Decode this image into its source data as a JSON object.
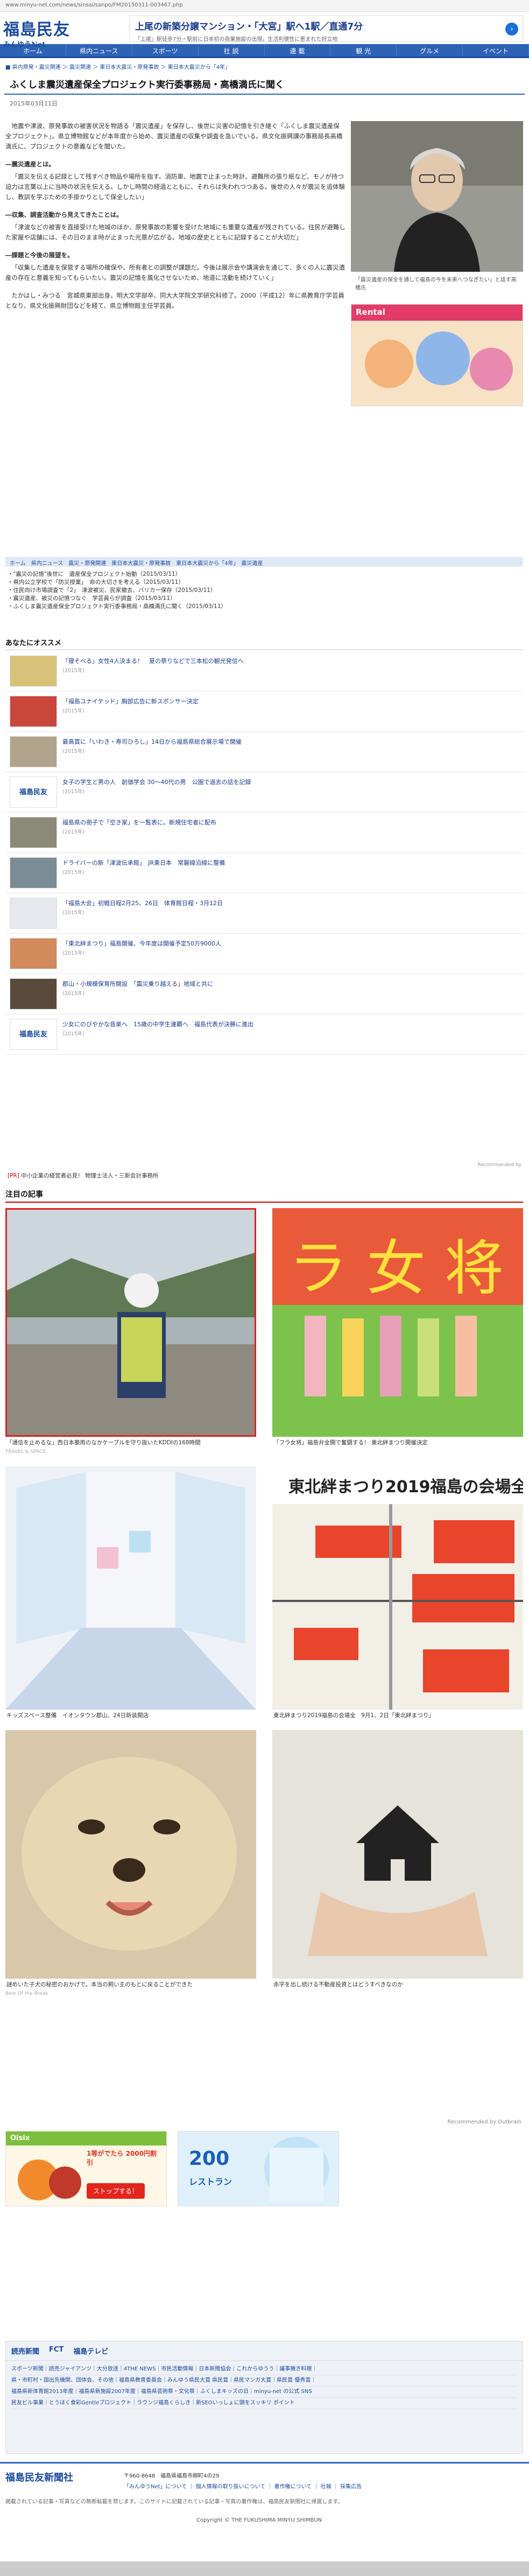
{
  "url": "www.minyu-net.com/news/sinsai/sanpo/FM20150311-003467.php",
  "site": {
    "logo_main": "福島民友",
    "logo_sub": "みんゆうNet"
  },
  "top_ad": {
    "title": "上尾の新築分譲マンション・「大宮」駅へ1駅／直通7分",
    "sub": "「上尾」駅徒歩7分・駅前に日本初の商業施設の出現。生活利便性に恵まれた好立地"
  },
  "nav": [
    "ホーム",
    "県内ニュース",
    "スポーツ",
    "社 説",
    "連 載",
    "観 光",
    "グルメ",
    "イベント"
  ],
  "breadcrumb": "■ 県内原発・震災関連 ＞ 震災関連 ＞ 東日本大震災・原発事故 ＞ 東日本大震災から「4年」",
  "article": {
    "title": "ふくしま震災遺産保全プロジェクト実行委事務局・高橋満氏に聞く",
    "date": "2015年03月11日",
    "paragraphs": [
      {
        "type": "p",
        "text": "地震や津波、原発事故の被害状況を物語る「震災遺産」を保存し、後世に災害の記憶を引き継ぐ「ふくしま震災遺産保全プロジェクト」。県立博物館などが本年度から始め、震災遺産の収集や調査を急いでいる。県文化振興課の事務局長高橋満氏に、プロジェクトの意義などを聞いた。"
      },
      {
        "type": "sub",
        "text": "―震災遺産とは。"
      },
      {
        "type": "p",
        "text": "「震災を伝える記録として残すべき物品や場所を指す。消防車、地震で止まった時計、避難所の張り紙など、モノが持つ迫力は言葉以上に当時の状況を伝える。しかし時間の経過とともに、それらは失われつつある。後世の人々が震災を追体験し、教訓を学ぶための手掛かりとして保全したい」"
      },
      {
        "type": "sub",
        "text": "―収集、調査活動から見えてきたことは。"
      },
      {
        "type": "p",
        "text": "「津波などの被害を直接受けた地域のほか、原発事故の影響を受けた地域にも重要な遺産が残されている。住民が避難した家屋や店舗には、その日のまま時が止まった光景が広がる。地域の歴史とともに記録することが大切だ」"
      },
      {
        "type": "sub",
        "text": "―課題と今後の展望を。"
      },
      {
        "type": "p",
        "text": "「収集した遺産を保管する場所の確保や、所有者との調整が課題だ。今後は展示会や講演会を通じて、多くの人に震災遺産の存在と意義を知ってもらいたい。震災の記憶を風化させないため、地道に活動を続けていく」"
      },
      {
        "type": "p",
        "text": "たかはし・みつる　宮城県東部出身。明大文学部卒、同大大学院文学研究科修了。2000（平成12）年に県教育庁学芸員となり、県文化振興財団などを経て、県立博物館主任学芸員。"
      }
    ],
    "photo_caption": "「震災遺産の保全を通して福島の今を未来へつなぎたい」と話す高橋氏",
    "side_ad_label": "Rental"
  },
  "tags": "ホーム　県内ニュース　震災・原発関連　東日本大震災・原発事故　東日本大震災から「4年」　震災遺産",
  "related": [
    "・\"震災の記憶\"後世に　遺産保全プロジェクト始動（2015/03/11）",
    "・県内公立学校で「防災授業」　命の大切さを考える（2015/03/11）",
    "・住民向け市場調査で「2」　津波被災、民家撤去、バリカー保存（2015/03/11）",
    "・震災遺産、被災の記憶つなぐ　学芸員らが調査（2015/03/11）",
    "・ふくしま震災遺産保全プロジェクト実行委事務局・高橋満氏に聞く（2015/03/11）"
  ],
  "osusume_title": "あなたにオススメ",
  "osusume": [
    {
      "title": "「寝そべる」女性4人決まる！　夏の祭りなどで三本松の観光発信へ",
      "date": "(2015年)"
    },
    {
      "title": "「福島ユナイテッド」胸部広告に新スポンサー決定",
      "date": "(2015年)"
    },
    {
      "title": "最高賞に「いわき・寿司ひろし」14日から福島県総合展示場で開催",
      "date": "(2015年)"
    },
    {
      "title": "女子の学生と男の人　創価学会 30〜40代の男　公園で過去の話を記録",
      "date": "(2015年)"
    },
    {
      "title": "福島県の冊子で「空き家」を一覧表に。新規住宅者に配布",
      "date": "(2015年)"
    },
    {
      "title": "ドライバーの新「津波伝承館」　JR東日本　常磐線沿線に整備",
      "date": "(2015年)"
    },
    {
      "title": "「福島大会」初戦日程2月25、26日　体育館日程・3月12日",
      "date": "(2015年)"
    },
    {
      "title": "「東北絆まつり」福島開催、今年度は開催予定50万9000人",
      "date": "(2015年)"
    },
    {
      "title": "郡山・小規模保育所開設　「震災乗り越える」地域と共に",
      "date": "(2015年)"
    },
    {
      "title": "少女にのびやかな音楽へ　15歳の中学生連覇ヘ　福島代表が決勝に進出",
      "date": "(2015年)"
    }
  ],
  "recommended_by": "Recommended by",
  "pr": {
    "badge": "[PR]",
    "text": "中小企業の経営者必見！ 物理士法人・三新会計事務所"
  },
  "cards_title": "注目の記事",
  "cards": [
    {
      "caption": "「通信を止めるな」西日本豪雨のなかケーブルを守り抜いたKDDIの168時間",
      "src": "TRAVEL & SPACE"
    },
    {
      "caption": "「フラ女将」福島弁全開で奮闘する！ 東北絆まつり開催決定",
      "src": ""
    },
    {
      "caption": "キッズスペース整備　イオンタウン郡山、24日新装開店",
      "src": ""
    },
    {
      "caption": "東北絆まつり2019福島の会場全　9月1、2日「東北絆まつり」",
      "src": ""
    },
    {
      "caption": "謎めいた子犬の秘密のおかげで。本当の飼い主のもとに戻ることができた",
      "src": "Best Of the Break"
    },
    {
      "caption": "赤字を出し続ける不動産投資とはどうすべきなのか",
      "src": ""
    }
  ],
  "outbrain": "Recommended by Outbrain",
  "ad1": {
    "title": "Oisix",
    "price": "1等がでたら 2000円割引",
    "btn": "ストップする！"
  },
  "ad2": {
    "line1": "200",
    "line2": "レストラン"
  },
  "footer_logos": [
    "読売新聞",
    "FCT",
    "福島テレビ"
  ],
  "footer_links": [
    "スポーツ新聞｜読売ジャイアンツ｜大分放送｜4THE NEWS｜市民活動情報｜日本新聞協会｜これからゆうう｜議事機き料理｜",
    "県・市町村・国出先機関、団体会、その他｜福島県教育委員会｜みんゆう県民大賞 県民賞｜県民マンガ大賞｜県民賞 優秀賞｜",
    "福島県新体育館2013年度｜福島県新施設2007年度｜福島県芸術祭・文化祭｜ふくしまキッズの日｜minyu-net の公式 SNS",
    "民友ビル事業｜とうほく食彩Gentleプロジェクト｜ラウンジ福島くらしき｜新SEOいっしょに頭をスッキリ ポイント"
  ],
  "footer": {
    "logo": "福島民友新聞社",
    "addr": "〒960-8648　福島県福島市柳町4の29",
    "links": "「みんゆうNet」について ｜ 個人情報の取り扱いについて ｜ 著作権について ｜ 社報 ｜ 採集広告",
    "note": "掲載されている記事・写真などの無断転載を禁じます。このサイトに記載されている記事・写真の著作権は、福島民友新聞社に帰属します。",
    "copy": "Copyright © THE FUKUSHIMA MINYU SHIMBUN"
  }
}
